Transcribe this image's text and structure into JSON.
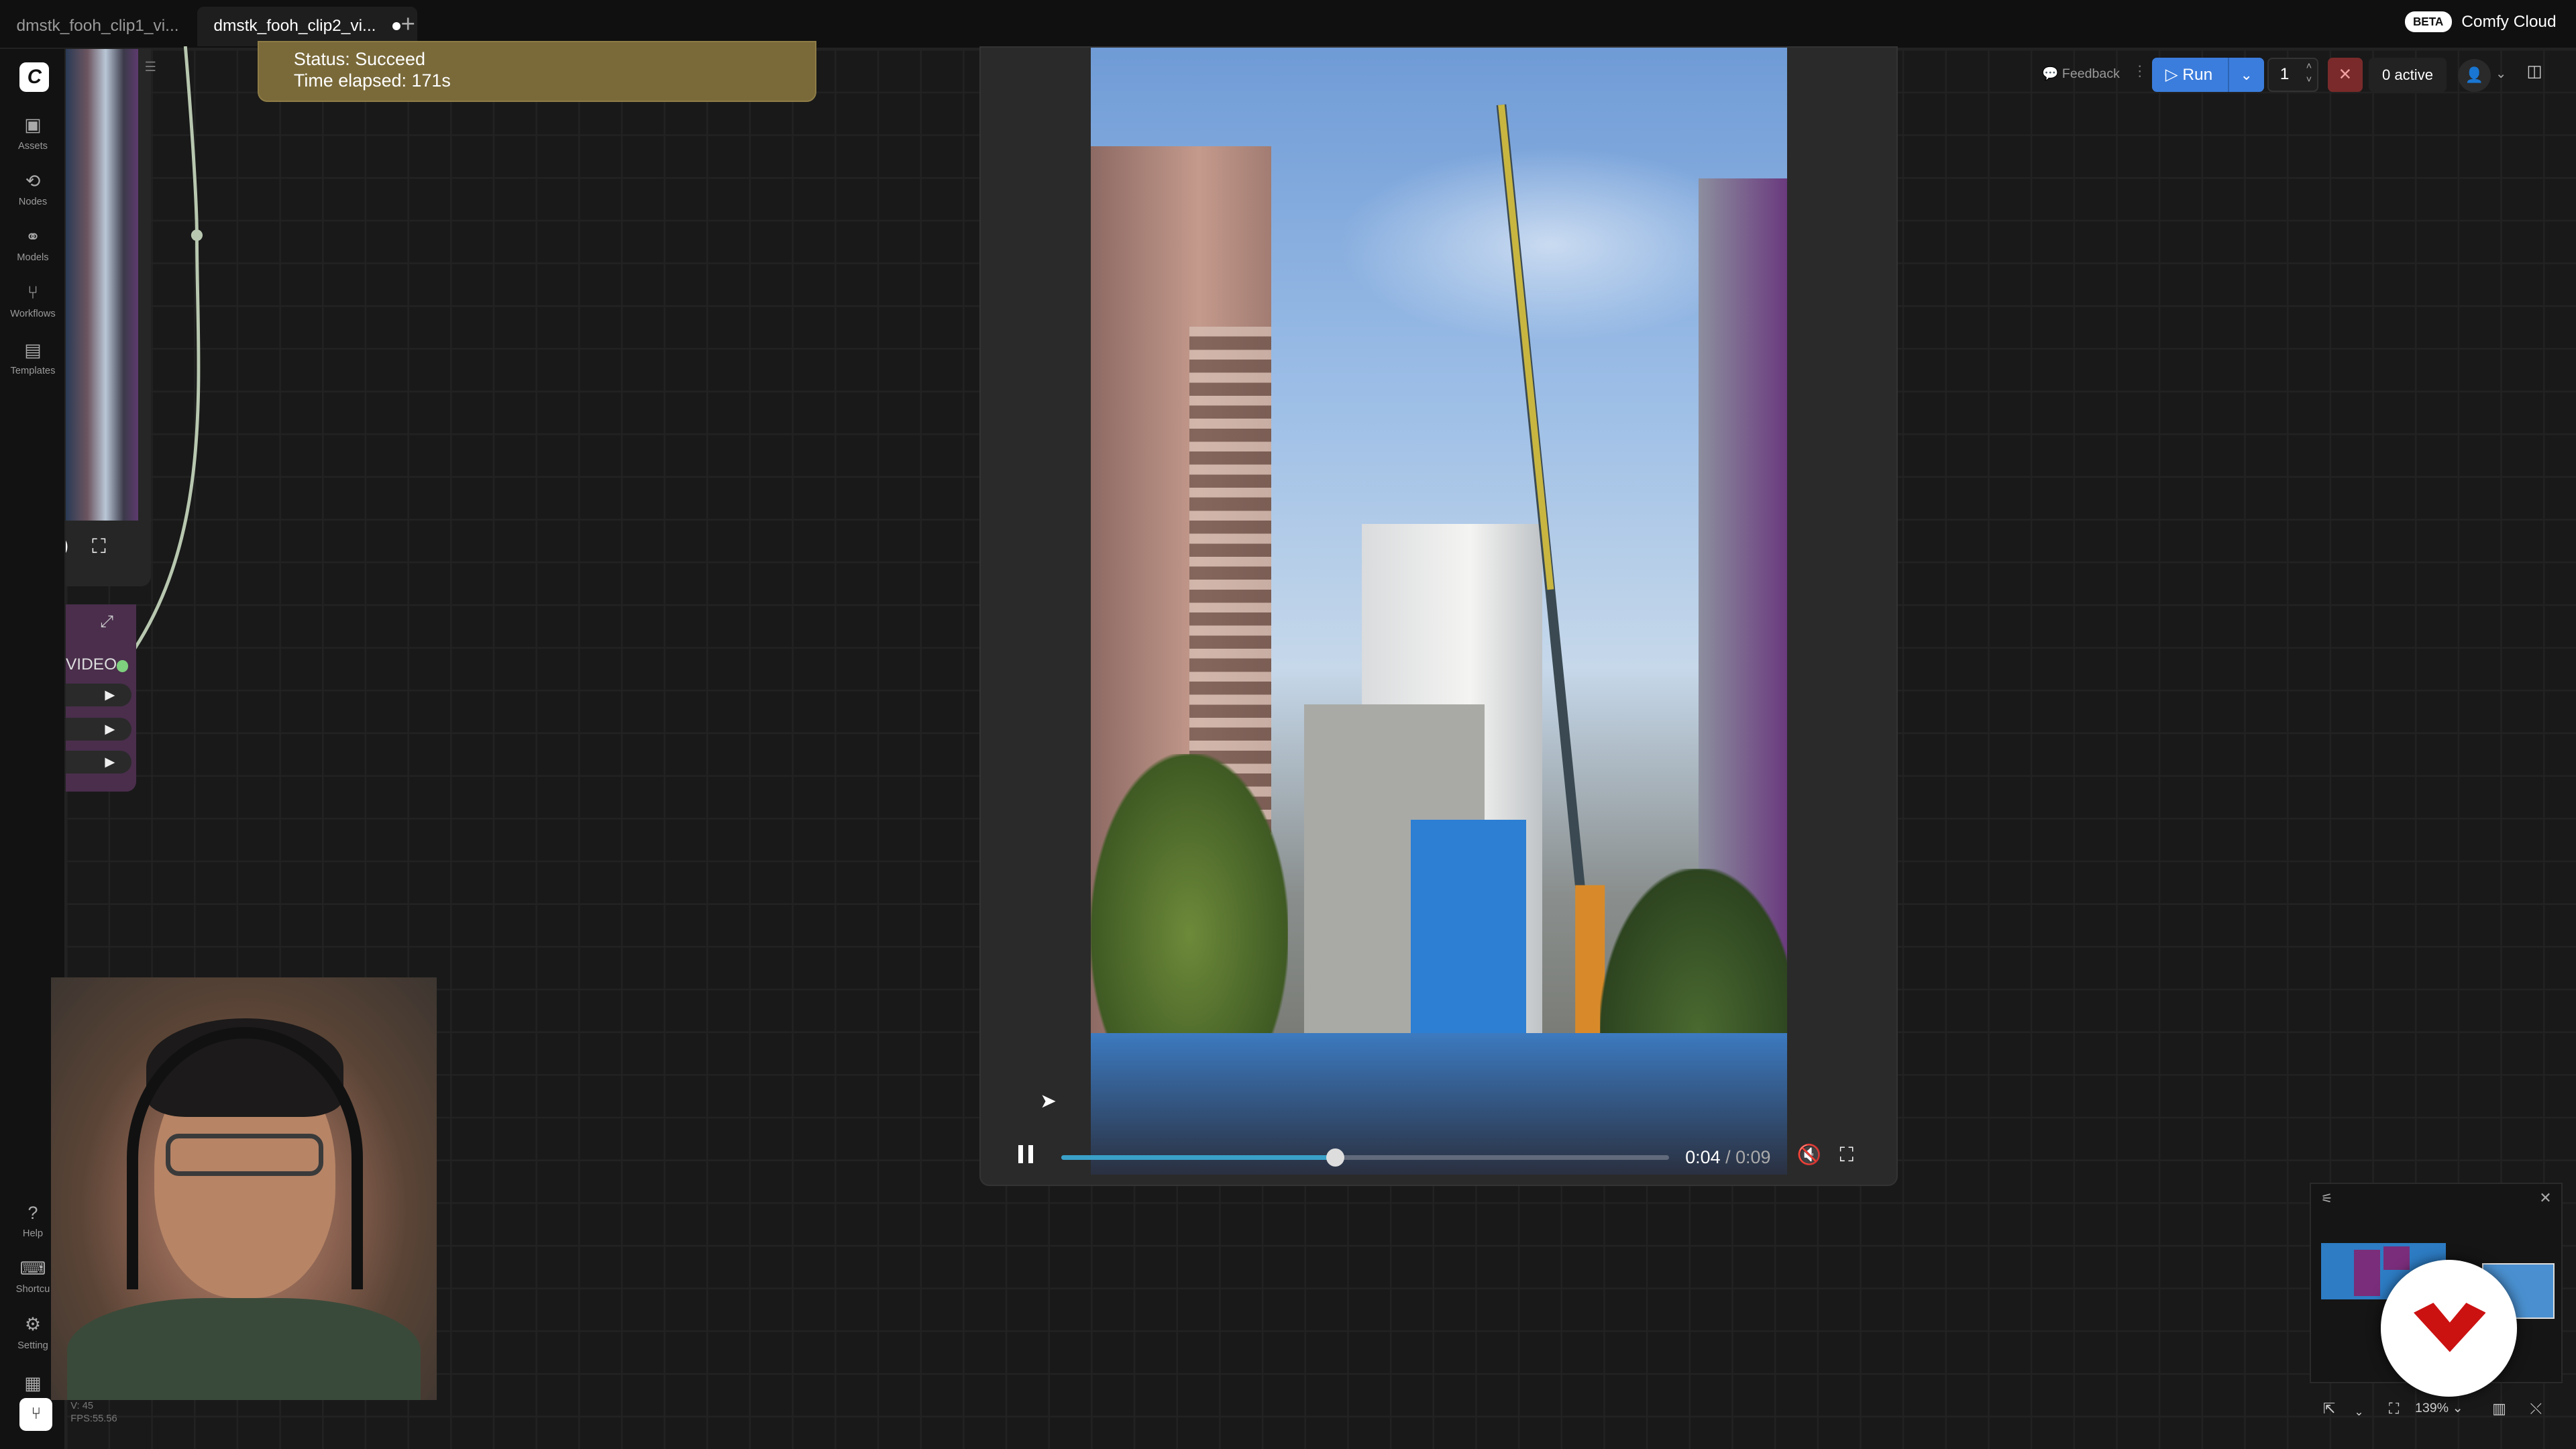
{
  "tabs": [
    {
      "label": "dmstk_fooh_clip1_vi...",
      "active": false
    },
    {
      "label": "dmstk_fooh_clip2_vi...",
      "active": true,
      "unsaved": true
    }
  ],
  "brand": {
    "beta": "BETA",
    "name": "Comfy Cloud"
  },
  "sidebar": {
    "items": [
      {
        "label": "Assets",
        "icon": "image-icon"
      },
      {
        "label": "Nodes",
        "icon": "nodes-icon"
      },
      {
        "label": "Models",
        "icon": "models-icon"
      },
      {
        "label": "Workflows",
        "icon": "workflows-icon"
      },
      {
        "label": "Templates",
        "icon": "templates-icon"
      }
    ],
    "bottom": [
      {
        "label": "Help",
        "icon": "help-icon"
      },
      {
        "label": "Shortcu",
        "icon": "keyboard-icon"
      },
      {
        "label": "Setting",
        "icon": "gear-icon"
      }
    ],
    "fps_line1": "V: 45",
    "fps_line2": "FPS:55.56"
  },
  "status_node": {
    "status": "Status: Succeed",
    "elapsed": "Time elapsed: 171s"
  },
  "video_node": {
    "output_label": "VIDEO"
  },
  "player": {
    "current": "0:04",
    "separator": "/",
    "duration": "0:09",
    "progress": 0.45
  },
  "toolbar": {
    "feedback": "Feedback",
    "run": "Run",
    "batch_count": "1",
    "active": "0 active"
  },
  "zoom": {
    "level": "139%"
  },
  "colors": {
    "run_button": "#3b7ddd",
    "status_node": "#7a6a3a",
    "video_node": "#4a2e4c",
    "progress": "#3aa0c8"
  }
}
